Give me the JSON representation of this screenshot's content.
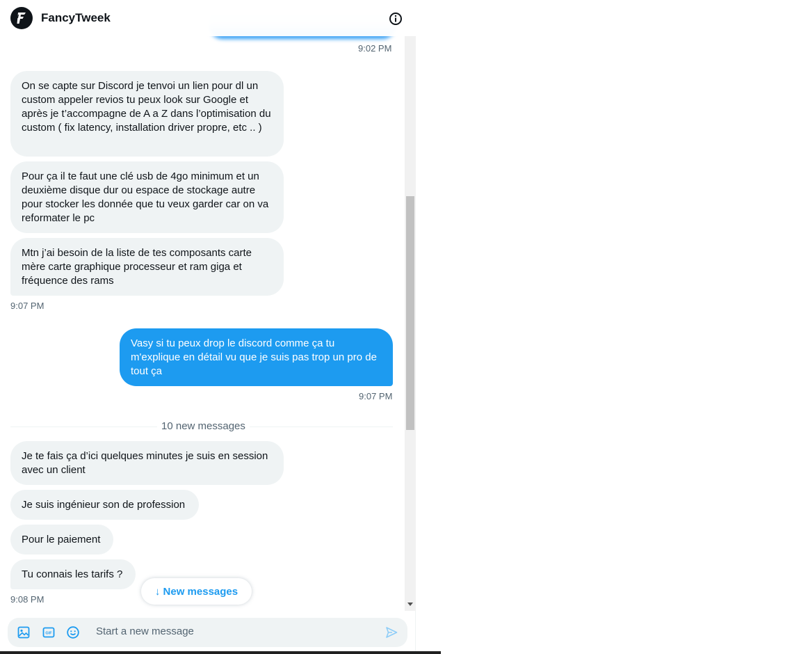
{
  "header": {
    "title": "FancyTweek",
    "avatar_letter": "F"
  },
  "messages": {
    "top_timestamp": "9:02 PM",
    "received_group_1": [
      "On se capte sur Discord je tenvoi un lien pour dl un custom appeler revios tu peux look sur Google et après je t’accompagne de A a Z dans l’optimisation du custom ( fix latency, installation driver propre, etc .. )",
      "Pour ça il te faut une clé usb de 4go minimum et un deuxième disque dur ou espace de stockage autre pour stocker les donnée que tu veux garder car on va reformater le pc",
      "Mtn j’ai besoin de la liste de tes composants carte mère carte graphique processeur et ram giga et fréquence des rams"
    ],
    "received_group_1_time": "9:07 PM",
    "sent_1": "Vasy si tu peux drop le discord comme ça tu m'explique en détail vu que je suis pas trop un pro de tout ça",
    "sent_1_time": "9:07 PM",
    "divider_label": "10 new messages",
    "received_group_2": [
      "Je te fais ça d’ici quelques minutes je suis en session avec un client",
      "Je suis ingénieur son de profession",
      "Pour le paiement",
      "Tu connais les tarifs ?"
    ],
    "received_group_2_time": "9:08 PM"
  },
  "new_messages_button": "↓ New messages",
  "composer": {
    "placeholder": "Start a new message",
    "icons": [
      "image-icon",
      "gif-icon",
      "emoji-icon",
      "send-icon"
    ]
  },
  "colors": {
    "accent": "#1d9bf0",
    "bubble_received": "#eff3f4",
    "text_secondary": "#536471"
  }
}
